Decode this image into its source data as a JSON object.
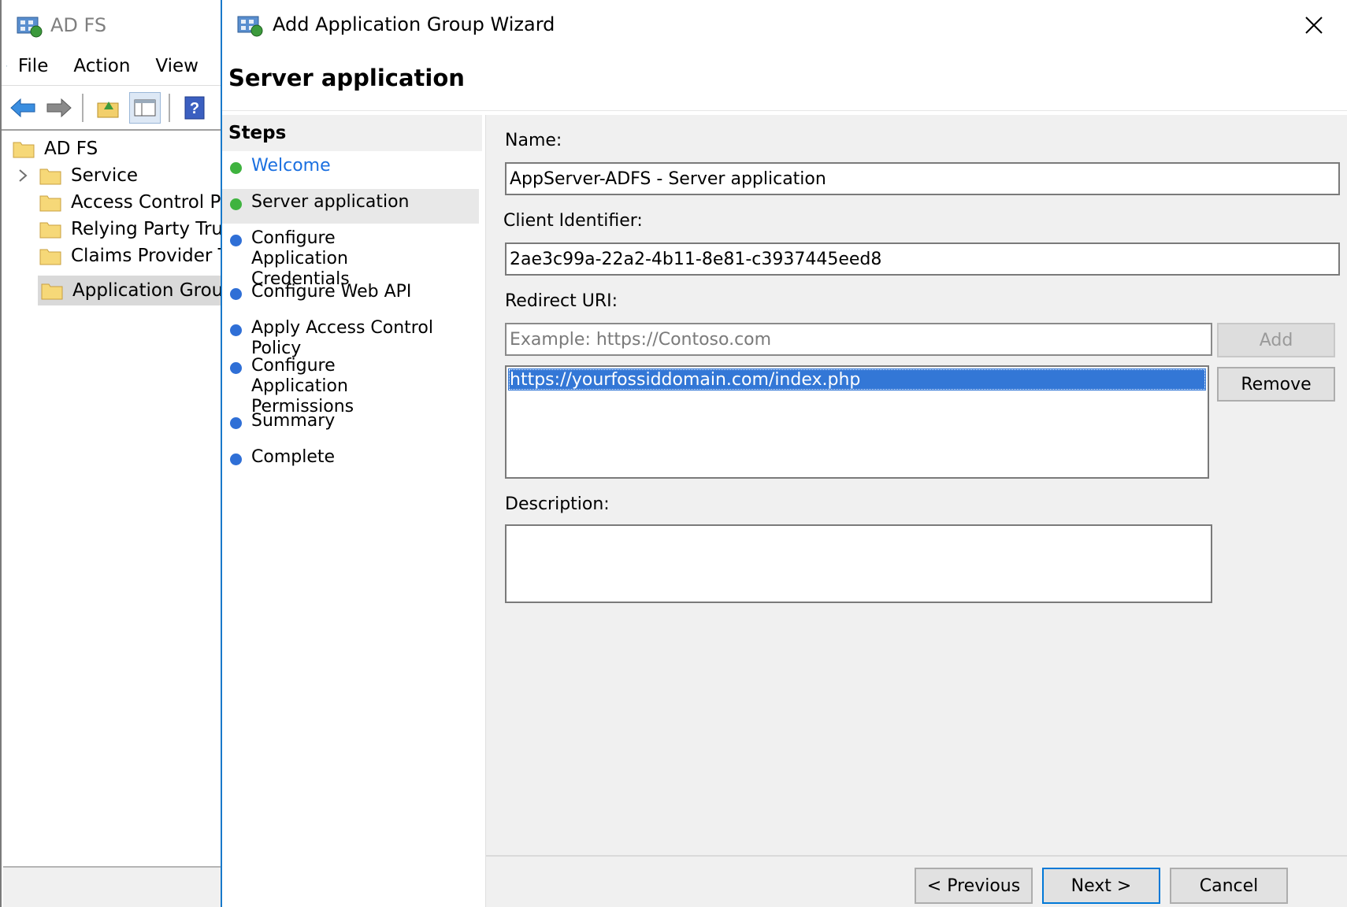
{
  "mmc": {
    "title": "AD FS",
    "menu": [
      "File",
      "Action",
      "View"
    ],
    "tree": {
      "root": "AD FS",
      "items": [
        "Service",
        "Access Control Policies",
        "Relying Party Trusts",
        "Claims Provider Trusts",
        "Application Groups"
      ],
      "selected": "Application Groups"
    }
  },
  "wizard": {
    "title": "Add Application Group Wizard",
    "heading": "Server application",
    "steps_header": "Steps",
    "steps": [
      {
        "label": "Welcome",
        "state": "done-link"
      },
      {
        "label": "Server application",
        "state": "current"
      },
      {
        "label": "Configure Application Credentials",
        "state": "pending"
      },
      {
        "label": "Configure Web API",
        "state": "pending"
      },
      {
        "label": "Apply Access Control Policy",
        "state": "pending"
      },
      {
        "label": "Configure Application Permissions",
        "state": "pending"
      },
      {
        "label": "Summary",
        "state": "pending"
      },
      {
        "label": "Complete",
        "state": "pending"
      }
    ],
    "form": {
      "name_label": "Name:",
      "name_value": "AppServer-ADFS - Server application",
      "client_id_label": "Client Identifier:",
      "client_id_value": "2ae3c99a-22a2-4b11-8e81-c3937445eed8",
      "redirect_label": "Redirect URI:",
      "redirect_placeholder": "Example: https://Contoso.com",
      "add_button": "Add",
      "remove_button": "Remove",
      "redirect_uris": [
        "https://yourfossiddomain.com/index.php"
      ],
      "description_label": "Description:",
      "description_value": ""
    },
    "buttons": {
      "previous": "< Previous",
      "next": "Next >",
      "cancel": "Cancel"
    }
  },
  "colors": {
    "step_done": "#3fb33f",
    "step_pending": "#2f6fd6",
    "link": "#1a6fe0",
    "selection": "#3377d6",
    "accent_border": "#1979ca"
  }
}
